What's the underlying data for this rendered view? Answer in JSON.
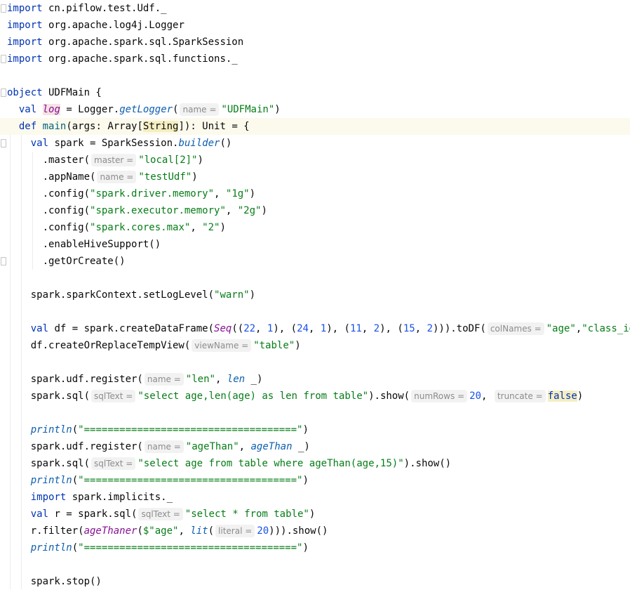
{
  "editor": {
    "lines": {
      "l1": {
        "kw": "import",
        "rest": " cn.piflow.test.Udf._"
      },
      "l2": {
        "kw": "import",
        "rest": " org.apache.log4j.Logger"
      },
      "l3": {
        "kw": "import",
        "rest": " org.apache.spark.sql.SparkSession"
      },
      "l4": {
        "kw": "import",
        "rest": " org.apache.spark.sql.functions._"
      },
      "l6": {
        "kw": "object",
        "rest": " UDFMain {"
      },
      "l7": {
        "kw": "val",
        "var": "log",
        "eq": " = Logger.",
        "call": "getLogger",
        "open": "(",
        "hint": "name =",
        "arg": "\"UDFMain\"",
        "close": ")"
      },
      "l8": {
        "kw": "def",
        "fn": " main",
        "p1": "(args: Array[",
        "type": "String",
        "p2": "]): Unit = {"
      },
      "l9": {
        "kw": "val",
        "p1": " spark = SparkSession.",
        "call": "builder",
        "p2": "()"
      },
      "l10": {
        "p1": ".master(",
        "hint": "master =",
        "arg": "\"local[2]\"",
        "close": ")"
      },
      "l11": {
        "p1": ".appName(",
        "hint": "name =",
        "arg": "\"testUdf\"",
        "close": ")"
      },
      "l12": {
        "p1": ".config(",
        "s1": "\"spark.driver.memory\"",
        "c": ", ",
        "s2": "\"1g\"",
        "close": ")"
      },
      "l13": {
        "p1": ".config(",
        "s1": "\"spark.executor.memory\"",
        "c": ", ",
        "s2": "\"2g\"",
        "close": ")"
      },
      "l14": {
        "p1": ".config(",
        "s1": "\"spark.cores.max\"",
        "c": ", ",
        "s2": "\"2\"",
        "close": ")"
      },
      "l15": {
        "p1": ".enableHiveSupport()"
      },
      "l16": {
        "p1": ".getOrCreate()"
      },
      "l18": {
        "p1": "spark.sparkContext.setLogLevel(",
        "s1": "\"warn\"",
        "close": ")"
      },
      "l20": {
        "kw": "val",
        "p1": " df = spark.createDataFrame(",
        "seq": "Seq",
        "p2": "((",
        "n1": "22",
        "c1": ", ",
        "n2": "1",
        "p3": "), (",
        "n3": "24",
        "c2": ", ",
        "n4": "1",
        "p4": "), (",
        "n5": "11",
        "c3": ", ",
        "n6": "2",
        "p5": "), (",
        "n7": "15",
        "c4": ", ",
        "n8": "2",
        "p6": "))).toDF(",
        "hint": "colNames =",
        "s1": "\"age\"",
        "c5": ",",
        "s2": "\"class_id\"",
        "close": ")"
      },
      "l21": {
        "p1": "df.createOrReplaceTempView(",
        "hint": "viewName =",
        "s1": "\"table\"",
        "close": ")"
      },
      "l23": {
        "p1": "spark.udf.register(",
        "hint": "name =",
        "s1": "\"len\"",
        "c": ", ",
        "it": "len",
        "close": " _)"
      },
      "l24": {
        "p1": "spark.sql(",
        "hint": "sqlText =",
        "s1": "\"select age,len(age) as len from table\"",
        "p2": ").show(",
        "hint2": "numRows =",
        "n1": "20",
        "c": ", ",
        "hint3": "truncate =",
        "kwf": "false",
        "close": ")"
      },
      "l26": {
        "it": "println",
        "p1": "(",
        "s1": "\"====================================\"",
        "close": ")"
      },
      "l27": {
        "p1": "spark.udf.register(",
        "hint": "name =",
        "s1": "\"ageThan\"",
        "c": ", ",
        "it": "ageThan",
        "close": " _)"
      },
      "l28": {
        "p1": "spark.sql(",
        "hint": "sqlText =",
        "s1": "\"select age from table where ageThan(age,15)\"",
        "close": ").show()"
      },
      "l29": {
        "it": "println",
        "p1": "(",
        "s1": "\"====================================\"",
        "close": ")"
      },
      "l30": {
        "kw": "import",
        "rest": " spark.implicits._"
      },
      "l31": {
        "kw": "val",
        "p1": " r = spark.sql(",
        "hint": "sqlText =",
        "s1": "\"select * from table\"",
        "close": ")"
      },
      "l32": {
        "p1": "r.filter(",
        "pur": "ageThaner",
        "p2": "(",
        "s1": "$\"age\"",
        "c": ", ",
        "it": "lit",
        "p3": "(",
        "hint": "literal =",
        "n1": "20",
        "close": "))).show()"
      },
      "l33": {
        "it": "println",
        "p1": "(",
        "s1": "\"====================================\"",
        "close": ")"
      },
      "l35": {
        "p1": "spark.stop()"
      }
    }
  }
}
